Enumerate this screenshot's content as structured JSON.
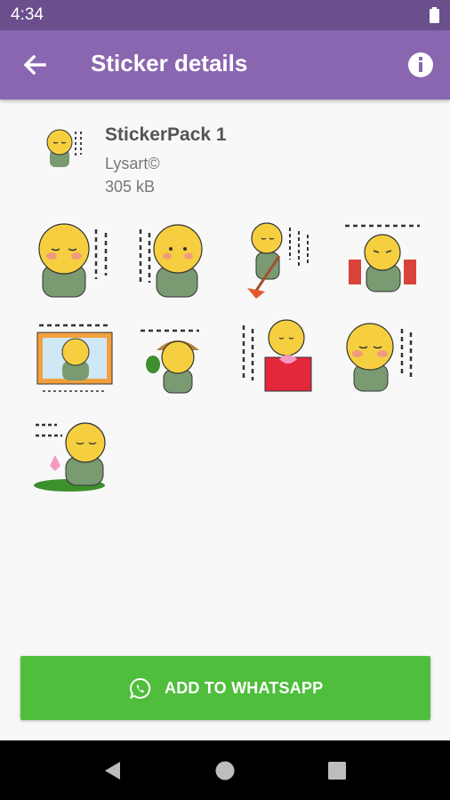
{
  "status_bar": {
    "time": "4:34",
    "battery_icon": "battery-full-icon"
  },
  "app_bar": {
    "title": "Sticker details",
    "back_icon": "arrow-back-icon",
    "info_icon": "info-icon"
  },
  "pack": {
    "name": "StickerPack 1",
    "publisher": "Lysart©",
    "size": "305 kB"
  },
  "stickers": [
    "sticker-1",
    "sticker-2",
    "sticker-3",
    "sticker-4",
    "sticker-5",
    "sticker-6",
    "sticker-7",
    "sticker-8",
    "sticker-9"
  ],
  "add_button": {
    "label": "ADD TO WHATSAPP",
    "icon": "whatsapp-icon",
    "color": "#4fbe3d"
  },
  "nav_bar": {
    "back_icon": "triangle-back-icon",
    "home_icon": "circle-home-icon",
    "recents_icon": "square-recents-icon"
  },
  "colors": {
    "status_bar": "#6b4f8c",
    "app_bar": "#8a66b0",
    "background": "#f8f8f8"
  }
}
